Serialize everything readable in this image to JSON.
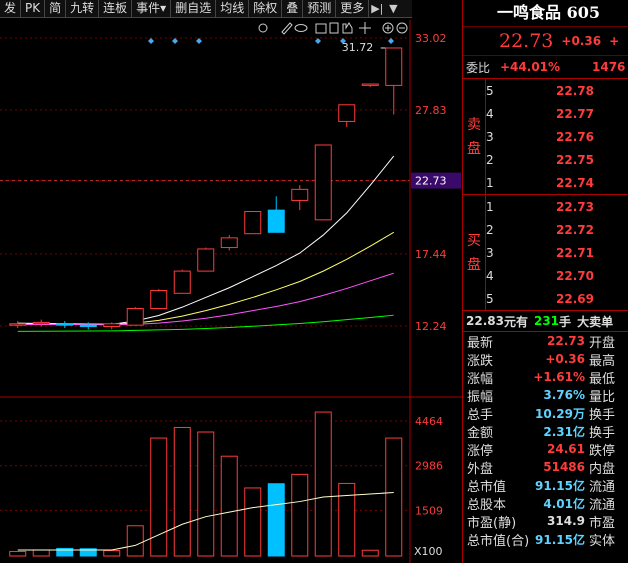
{
  "toolbar": {
    "items": [
      "发",
      "PK",
      "简",
      "九转",
      "连板",
      "事件▾",
      "删自选",
      "均线",
      "除权",
      "叠",
      "预测",
      "更多"
    ]
  },
  "axis": {
    "price_ticks": [
      "33.02",
      "27.83",
      "22.73",
      "17.44",
      "12.24"
    ],
    "volume_ticks": [
      "4464",
      "2986",
      "1509"
    ],
    "volume_unit": "X100",
    "high_marker": "31.72"
  },
  "colors": {
    "up": "#ff3b3b",
    "down": "#00c0ff",
    "bg": "#000000",
    "grid": "#7a0000",
    "ma1": "#ffffff",
    "ma2": "#ffff66",
    "ma3": "#ff55ff",
    "ma4": "#00ff00"
  },
  "chart_data": {
    "type": "candlestick",
    "price_ylim": [
      12.24,
      33.02
    ],
    "volume_ylim": [
      0,
      4464
    ],
    "candles": [
      {
        "o": 12.3,
        "h": 12.6,
        "l": 12.1,
        "c": 12.4,
        "v": 150
      },
      {
        "o": 12.4,
        "h": 12.7,
        "l": 12.2,
        "c": 12.5,
        "v": 200
      },
      {
        "o": 12.4,
        "h": 12.6,
        "l": 12.1,
        "c": 12.3,
        "v": 250
      },
      {
        "o": 12.3,
        "h": 12.5,
        "l": 12.0,
        "c": 12.2,
        "v": 240
      },
      {
        "o": 12.2,
        "h": 12.5,
        "l": 12.0,
        "c": 12.4,
        "v": 180
      },
      {
        "o": 12.3,
        "h": 13.6,
        "l": 12.3,
        "c": 13.5,
        "v": 1000
      },
      {
        "o": 13.5,
        "h": 14.9,
        "l": 13.5,
        "c": 14.8,
        "v": 3900
      },
      {
        "o": 14.6,
        "h": 16.3,
        "l": 14.6,
        "c": 16.2,
        "v": 4250
      },
      {
        "o": 16.2,
        "h": 17.9,
        "l": 16.2,
        "c": 17.8,
        "v": 4100
      },
      {
        "o": 17.9,
        "h": 18.8,
        "l": 17.7,
        "c": 18.6,
        "v": 3300
      },
      {
        "o": 18.9,
        "h": 20.5,
        "l": 18.9,
        "c": 20.5,
        "v": 2250
      },
      {
        "o": 20.6,
        "h": 21.6,
        "l": 19.0,
        "c": 19.0,
        "v": 2390
      },
      {
        "o": 21.3,
        "h": 22.4,
        "l": 20.6,
        "c": 22.1,
        "v": 2700
      },
      {
        "o": 19.9,
        "h": 25.3,
        "l": 19.9,
        "c": 25.3,
        "v": 4760
      },
      {
        "o": 27.0,
        "h": 28.2,
        "l": 26.6,
        "c": 28.2,
        "v": 2400
      },
      {
        "o": 29.6,
        "h": 29.7,
        "l": 29.5,
        "c": 29.7,
        "v": 190
      },
      {
        "o": 29.6,
        "h": 32.3,
        "l": 27.5,
        "c": 32.3,
        "v": 3900
      }
    ],
    "ma_lines": [
      {
        "name": "ma1",
        "values": [
          12.45,
          12.42,
          12.4,
          12.38,
          12.36,
          12.6,
          13.0,
          13.6,
          14.3,
          15.0,
          15.8,
          16.6,
          17.5,
          18.8,
          20.4,
          22.4,
          24.5
        ]
      },
      {
        "name": "ma2",
        "values": [
          12.4,
          12.4,
          12.39,
          12.38,
          12.36,
          12.45,
          12.65,
          12.95,
          13.35,
          13.8,
          14.3,
          14.85,
          15.45,
          16.2,
          17.05,
          18.0,
          19.0
        ]
      },
      {
        "name": "ma3",
        "values": [
          12.35,
          12.35,
          12.35,
          12.34,
          12.33,
          12.36,
          12.45,
          12.6,
          12.8,
          13.05,
          13.35,
          13.65,
          14.0,
          14.45,
          14.95,
          15.5,
          16.05
        ]
      },
      {
        "name": "ma4",
        "values": [
          11.85,
          11.86,
          11.87,
          11.88,
          11.89,
          11.92,
          11.96,
          12.0,
          12.06,
          12.13,
          12.22,
          12.32,
          12.42,
          12.55,
          12.7,
          12.85,
          13.02
        ]
      }
    ],
    "vol_ma": [
      200,
      200,
      200,
      200,
      200,
      350,
      700,
      1050,
      1300,
      1450,
      1600,
      1700,
      1800,
      1950,
      2000,
      2050,
      2100
    ]
  },
  "right": {
    "title": "一鸣食品 605",
    "price": "22.73",
    "change": "+0.36",
    "change_tail": "+",
    "weibi_label": "委比",
    "weibi": "+44.01%",
    "weicha": "1476",
    "sell_label": [
      "卖",
      "盘"
    ],
    "buy_label": [
      "买",
      "盘"
    ],
    "sell": [
      {
        "n": "5",
        "p": "22.78"
      },
      {
        "n": "4",
        "p": "22.77"
      },
      {
        "n": "3",
        "p": "22.76"
      },
      {
        "n": "2",
        "p": "22.75"
      },
      {
        "n": "1",
        "p": "22.74"
      }
    ],
    "buy": [
      {
        "n": "1",
        "p": "22.73"
      },
      {
        "n": "2",
        "p": "22.72"
      },
      {
        "n": "3",
        "p": "22.71"
      },
      {
        "n": "4",
        "p": "22.70"
      },
      {
        "n": "5",
        "p": "22.69"
      }
    ],
    "vol_line": {
      "price": "22.83",
      "unit1": "元有",
      "qty": "231",
      "unit2": "手",
      "tail": "大卖单"
    },
    "stats": [
      {
        "k": "最新",
        "v": "22.73",
        "c": "red",
        "k2": "开盘"
      },
      {
        "k": "涨跌",
        "v": "+0.36",
        "c": "red",
        "k2": "最高"
      },
      {
        "k": "涨幅",
        "v": "+1.61%",
        "c": "red",
        "k2": "最低"
      },
      {
        "k": "振幅",
        "v": "3.76%",
        "c": "cyan",
        "k2": "量比"
      },
      {
        "k": "总手",
        "v": "10.29万",
        "c": "cyan",
        "k2": "换手"
      },
      {
        "k": "金额",
        "v": "2.31亿",
        "c": "cyan",
        "k2": "换手"
      },
      {
        "k": "涨停",
        "v": "24.61",
        "c": "red",
        "k2": "跌停"
      },
      {
        "k": "外盘",
        "v": "51486",
        "c": "red",
        "k2": "内盘"
      },
      {
        "k": "总市值",
        "v": "91.15亿",
        "c": "cyan",
        "k2": "流通"
      },
      {
        "k": "总股本",
        "v": "4.01亿",
        "c": "cyan",
        "k2": "流通"
      },
      {
        "k": "市盈(静)",
        "v": "314.9",
        "c": "white",
        "k2": "市盈"
      },
      {
        "k": "总市值(合)",
        "v": "91.15亿",
        "c": "cyan",
        "k2": "实体"
      }
    ]
  }
}
